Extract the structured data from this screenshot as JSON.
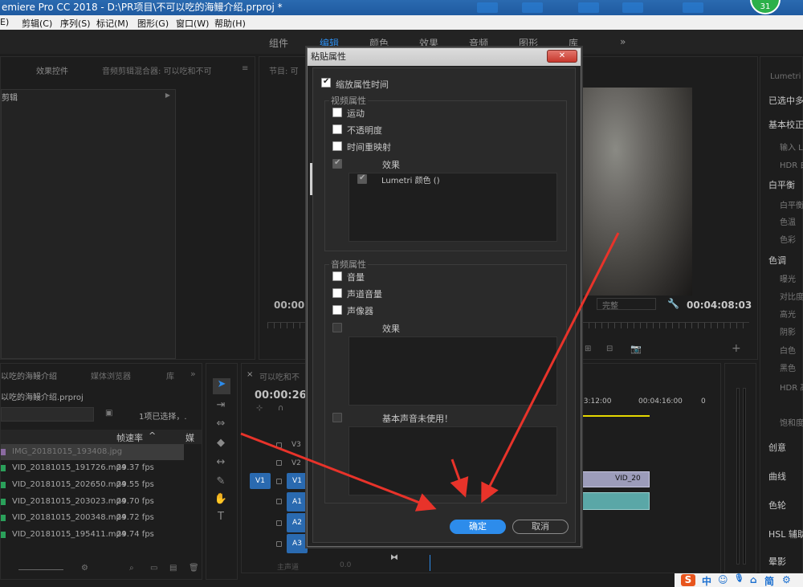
{
  "window": {
    "title": "emiere Pro CC 2018 - D:\\PR项目\\不可以吃的海鳗介绍.prproj *",
    "badge": "31"
  },
  "menu": [
    "E)",
    "剪辑(C)",
    "序列(S)",
    "标记(M)",
    "图形(G)",
    "窗口(W)",
    "帮助(H)"
  ],
  "workspaces": {
    "items": [
      "组件",
      "编辑",
      "颜色",
      "效果",
      "音频",
      "图形",
      "库"
    ],
    "more": "»",
    "active": "编辑"
  },
  "source_panel": {
    "tab_effect_controls": "效果控件",
    "tab_audio_mixer": "音频剪辑混合器: 可以吃和不可",
    "tab_menu": "≡",
    "clip_label": "剪辑"
  },
  "program_panel": {
    "tab": "节目: 可",
    "timecode_left": "00:00:2",
    "timecode_right": "00:04:08:03",
    "quality": "完整"
  },
  "project_panel": {
    "tab_project": "以吃的海鳗介绍",
    "tab_media_browser": "媒体浏览器",
    "tab_libraries": "库",
    "file_name": "以吃的海鳗介绍.prproj",
    "selection_info": "1项已选择，.",
    "col_framerate": "帧速率",
    "col_media": "媒",
    "items": [
      {
        "name": "IMG_20181015_193408.jpg",
        "fps": ""
      },
      {
        "name": "VID_20181015_191726.mp4",
        "fps": "29.37 fps"
      },
      {
        "name": "VID_20181015_202650.mp4",
        "fps": "29.55 fps"
      },
      {
        "name": "VID_20181015_203023.mp4",
        "fps": "29.70 fps"
      },
      {
        "name": "VID_20181015_200348.mp4",
        "fps": "29.72 fps"
      },
      {
        "name": "VID_20181015_195411.mp4",
        "fps": "29.74 fps"
      }
    ]
  },
  "timeline": {
    "tab": "可以吃和不",
    "timecode": "00:00:26:",
    "ruler": [
      "03:12:00",
      "00:04:16:00",
      "0"
    ],
    "tracks": {
      "v1_src": "V1",
      "v3": "V3",
      "v2": "V2",
      "v1": "V1",
      "a1": "A1",
      "a2": "A2",
      "a3": "A3"
    },
    "clip_label": "VID_20",
    "master_label": "主声道",
    "master_value": "0.0"
  },
  "lumetri": {
    "tab": "Lumetri 颜",
    "selected": "已选中多",
    "sections": [
      "基本校正",
      "创意",
      "曲线",
      "色轮",
      "HSL 辅助",
      "晕影"
    ],
    "items": [
      "输入 L",
      "HDR 白",
      "白平衡",
      "白平衡",
      "色温",
      "色彩",
      "色调",
      "曝光",
      "对比度",
      "高光",
      "阴影",
      "白色",
      "黑色",
      "HDR 高",
      "饱和度"
    ]
  },
  "dialog": {
    "title": "粘贴属性",
    "close": "✕",
    "scale_time": "缩放属性时间",
    "video_group": "视频属性",
    "motion": "运动",
    "opacity": "不透明度",
    "time_remap": "时间重映射",
    "effects": "效果",
    "lumetri_effect": "Lumetri 颜色 ()",
    "audio_group": "音频属性",
    "volume": "音量",
    "channel_volume": "声道音量",
    "panner": "声像器",
    "audio_effects": "效果",
    "essential_sound": "基本声音未使用！",
    "ok": "确定",
    "cancel": "取消",
    "checks": {
      "scale_time": true,
      "motion": false,
      "opacity": false,
      "time_remap": false,
      "effects": true,
      "lumetri": true,
      "volume": false,
      "channel_volume": false,
      "panner": false
    }
  },
  "tray": [
    "S",
    "中",
    "☺",
    "🎙",
    "⌂",
    "简",
    "⚙"
  ],
  "colors": {
    "accent": "#2d8ceb",
    "arrow": "#e8332a"
  }
}
